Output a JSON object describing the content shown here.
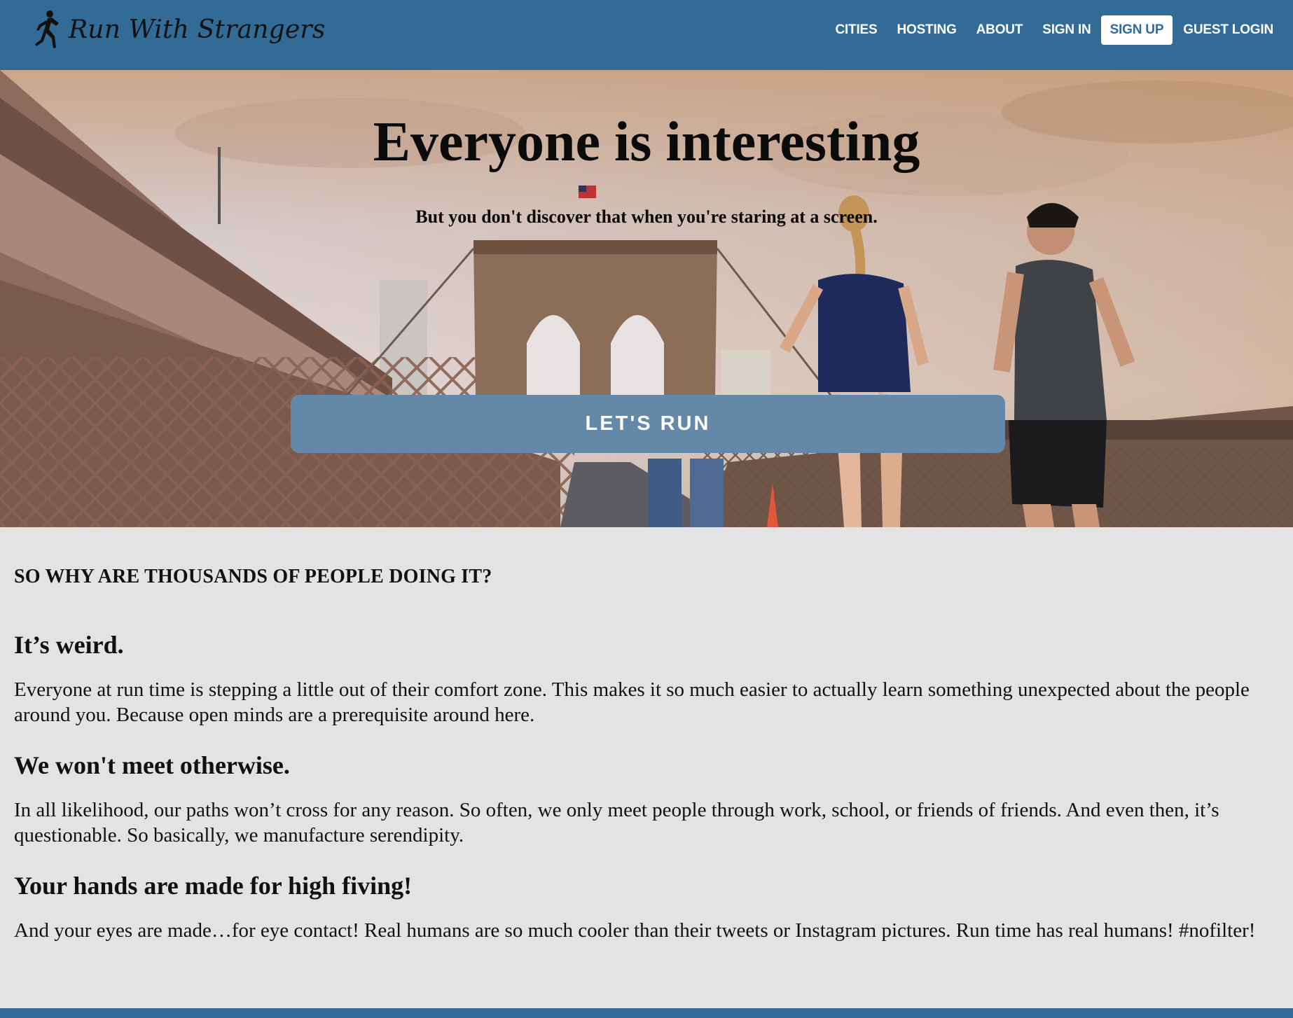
{
  "header": {
    "logo_text": "Run With Strangers",
    "logo_icon": "runner-icon",
    "nav": [
      {
        "label": "CITIES"
      },
      {
        "label": "HOSTING"
      },
      {
        "label": "ABOUT"
      },
      {
        "label": "SIGN IN"
      },
      {
        "label": "SIGN UP"
      },
      {
        "label": "GUEST LOGIN"
      }
    ]
  },
  "hero": {
    "title": "Everyone is interesting",
    "subtitle": "But you don't discover that when you're staring at a screen.",
    "cta_label": "LET'S RUN"
  },
  "main": {
    "section_heading": "SO WHY ARE THOUSANDS OF PEOPLE DOING IT?",
    "items": [
      {
        "title": "It’s weird.",
        "body": "Everyone at run time is stepping a little out of their comfort zone. This makes it so much easier to actually learn something unexpected about the people around you. Because open minds are a prerequisite around here."
      },
      {
        "title": "We won't meet otherwise.",
        "body": "In all likelihood, our paths won’t cross for any reason. So often, we only meet people through work, school, or friends of friends. And even then, it’s questionable. So basically, we manufacture serendipity."
      },
      {
        "title": "Your hands are made for high fiving!",
        "body": "And your eyes are made…for eye contact! Real humans are so much cooler than their tweets or Instagram pictures. Run time has real humans! #nofilter!"
      }
    ]
  },
  "colors": {
    "nav_bg": "#336b97",
    "cta_bg": "#6488a8",
    "page_bg": "#e3e3e3"
  }
}
